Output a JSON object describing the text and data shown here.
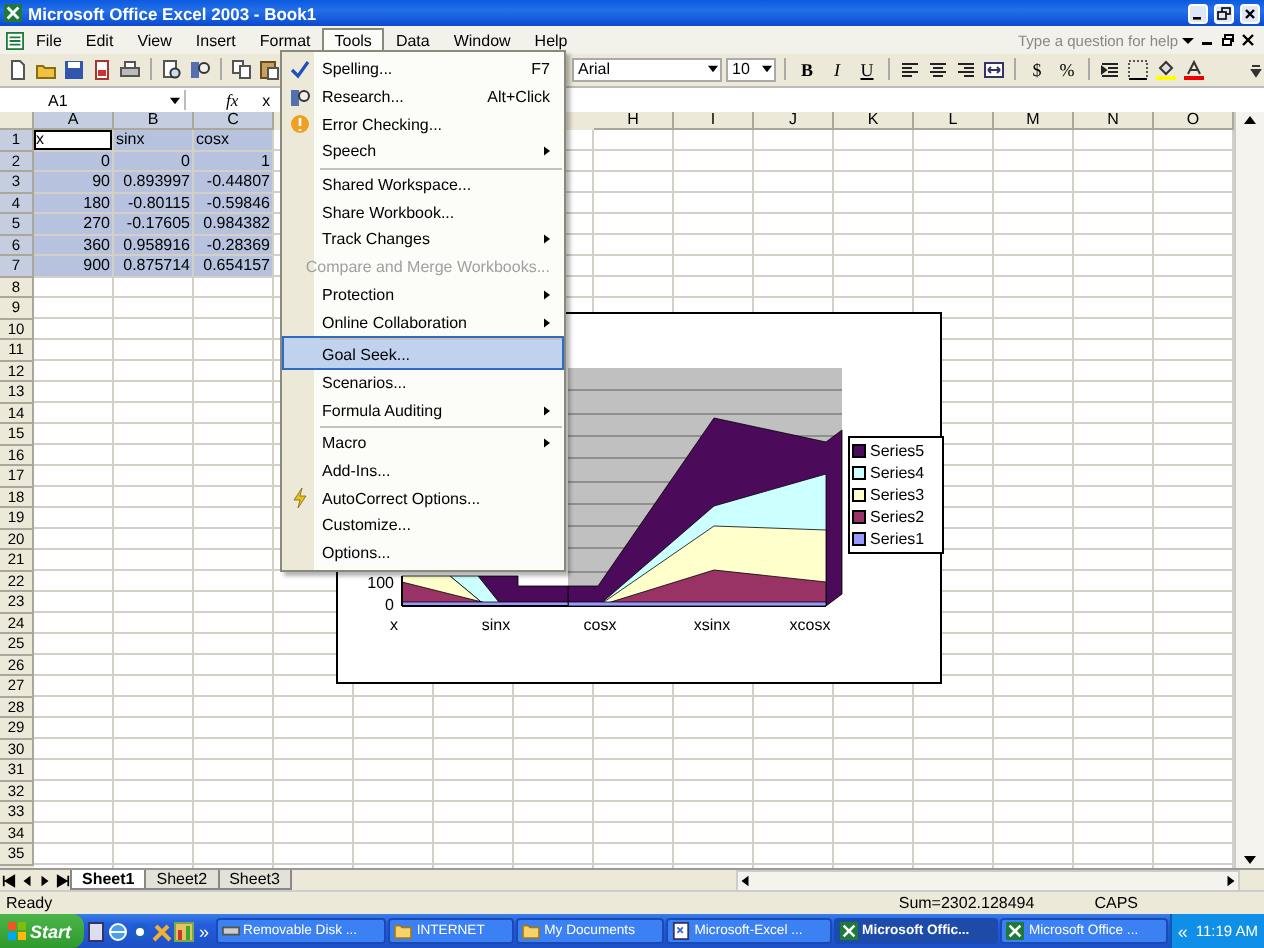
{
  "window": {
    "title": "Microsoft Office Excel 2003 - Book1"
  },
  "menu_bar": {
    "items": [
      {
        "label": "File",
        "selected": false
      },
      {
        "label": "Edit",
        "selected": false
      },
      {
        "label": "View",
        "selected": false
      },
      {
        "label": "Insert",
        "selected": false
      },
      {
        "label": "Format",
        "selected": false
      },
      {
        "label": "Tools",
        "selected": true
      },
      {
        "label": "Data",
        "selected": false
      },
      {
        "label": "Window",
        "selected": false
      },
      {
        "label": "Help",
        "selected": false
      }
    ],
    "help_placeholder": "Type a question for help"
  },
  "toolbar": {
    "font": "Arial",
    "font_size": "10",
    "style_buttons": [
      "B",
      "I",
      "U"
    ],
    "number_buttons": [
      "$",
      "%"
    ]
  },
  "formula_bar": {
    "name_box": "A1",
    "function_label": "fx",
    "formula": "x"
  },
  "sheet": {
    "columns": [
      {
        "label": "A",
        "selected": true
      },
      {
        "label": "B",
        "selected": true
      },
      {
        "label": "C",
        "selected": true
      },
      {
        "label": "H",
        "selected": false
      },
      {
        "label": "I",
        "selected": false
      },
      {
        "label": "J",
        "selected": false
      },
      {
        "label": "K",
        "selected": false
      },
      {
        "label": "L",
        "selected": false
      },
      {
        "label": "M",
        "selected": false
      },
      {
        "label": "N",
        "selected": false
      },
      {
        "label": "O",
        "selected": false
      }
    ],
    "rows": [
      {
        "header": "1",
        "selected": true,
        "cells": [
          {
            "text": "x",
            "kind": "label",
            "active": true
          },
          {
            "text": "sinx",
            "kind": "label",
            "active": false
          },
          {
            "text": "cosx",
            "kind": "label",
            "active": false
          }
        ]
      },
      {
        "header": "2",
        "selected": true,
        "cells": [
          {
            "text": "0",
            "kind": "number",
            "active": false
          },
          {
            "text": "0",
            "kind": "number",
            "active": false
          },
          {
            "text": "1",
            "kind": "number",
            "active": false
          }
        ]
      },
      {
        "header": "3",
        "selected": true,
        "cells": [
          {
            "text": "90",
            "kind": "number",
            "active": false
          },
          {
            "text": "0.893997",
            "kind": "number",
            "active": false
          },
          {
            "text": "-0.44807",
            "kind": "number",
            "active": false
          }
        ]
      },
      {
        "header": "4",
        "selected": true,
        "cells": [
          {
            "text": "180",
            "kind": "number",
            "active": false
          },
          {
            "text": "-0.80115",
            "kind": "number",
            "active": false
          },
          {
            "text": "-0.59846",
            "kind": "number",
            "active": false
          }
        ]
      },
      {
        "header": "5",
        "selected": true,
        "cells": [
          {
            "text": "270",
            "kind": "number",
            "active": false
          },
          {
            "text": "-0.17605",
            "kind": "number",
            "active": false
          },
          {
            "text": "0.984382",
            "kind": "number",
            "active": false
          }
        ]
      },
      {
        "header": "6",
        "selected": true,
        "cells": [
          {
            "text": "360",
            "kind": "number",
            "active": false
          },
          {
            "text": "0.958916",
            "kind": "number",
            "active": false
          },
          {
            "text": "-0.28369",
            "kind": "number",
            "active": false
          }
        ]
      },
      {
        "header": "7",
        "selected": true,
        "cells": [
          {
            "text": "900",
            "kind": "number",
            "active": false
          },
          {
            "text": "0.875714",
            "kind": "number",
            "active": false
          },
          {
            "text": "0.654157",
            "kind": "number",
            "active": false
          }
        ]
      },
      {
        "header": "8",
        "selected": false,
        "cells": []
      },
      {
        "header": "9",
        "selected": false,
        "cells": []
      },
      {
        "header": "10",
        "selected": false,
        "cells": []
      },
      {
        "header": "11",
        "selected": false,
        "cells": []
      },
      {
        "header": "12",
        "selected": false,
        "cells": []
      },
      {
        "header": "13",
        "selected": false,
        "cells": []
      },
      {
        "header": "14",
        "selected": false,
        "cells": []
      },
      {
        "header": "15",
        "selected": false,
        "cells": []
      },
      {
        "header": "16",
        "selected": false,
        "cells": []
      },
      {
        "header": "17",
        "selected": false,
        "cells": []
      },
      {
        "header": "18",
        "selected": false,
        "cells": []
      },
      {
        "header": "19",
        "selected": false,
        "cells": []
      },
      {
        "header": "20",
        "selected": false,
        "cells": []
      },
      {
        "header": "21",
        "selected": false,
        "cells": []
      },
      {
        "header": "22",
        "selected": false,
        "cells": []
      },
      {
        "header": "23",
        "selected": false,
        "cells": []
      },
      {
        "header": "24",
        "selected": false,
        "cells": []
      },
      {
        "header": "25",
        "selected": false,
        "cells": []
      },
      {
        "header": "26",
        "selected": false,
        "cells": []
      },
      {
        "header": "27",
        "selected": false,
        "cells": []
      },
      {
        "header": "28",
        "selected": false,
        "cells": []
      },
      {
        "header": "29",
        "selected": false,
        "cells": []
      },
      {
        "header": "30",
        "selected": false,
        "cells": []
      },
      {
        "header": "31",
        "selected": false,
        "cells": []
      },
      {
        "header": "32",
        "selected": false,
        "cells": []
      },
      {
        "header": "33",
        "selected": false,
        "cells": []
      },
      {
        "header": "34",
        "selected": false,
        "cells": []
      },
      {
        "header": "35",
        "selected": false,
        "cells": []
      }
    ]
  },
  "chart": {
    "y_ticks": [
      "100",
      "0"
    ],
    "categories": [
      "x",
      "sinx",
      "cosx",
      "xsinx",
      "xcosx"
    ],
    "legend": [
      {
        "label": "Series5",
        "color": "#4b0a5a"
      },
      {
        "label": "Series4",
        "color": "#ccffff"
      },
      {
        "label": "Series3",
        "color": "#ffffcc"
      },
      {
        "label": "Series2",
        "color": "#993366"
      },
      {
        "label": "Series1",
        "color": "#9999ff"
      }
    ]
  },
  "tools_menu": {
    "items": [
      {
        "label": "Spelling...",
        "shortcut": "F7",
        "kind": "spelling",
        "submenu": false,
        "disabled": false,
        "selected": false,
        "separator_before": false
      },
      {
        "label": "Research...",
        "shortcut": "Alt+Click",
        "kind": "research",
        "submenu": false,
        "disabled": false,
        "selected": false,
        "separator_before": false
      },
      {
        "label": "Error Checking...",
        "kind": "error",
        "submenu": false,
        "disabled": false,
        "selected": false,
        "separator_before": false
      },
      {
        "label": "Speech",
        "kind": "plain",
        "submenu": true,
        "disabled": false,
        "selected": false,
        "separator_before": false
      },
      {
        "label": "Shared Workspace...",
        "kind": "plain",
        "submenu": false,
        "disabled": false,
        "selected": false,
        "separator_before": true
      },
      {
        "label": "Share Workbook...",
        "kind": "plain",
        "submenu": false,
        "disabled": false,
        "selected": false,
        "separator_before": false
      },
      {
        "label": "Track Changes",
        "kind": "plain",
        "submenu": true,
        "disabled": false,
        "selected": false,
        "separator_before": false
      },
      {
        "label": "Compare and Merge Workbooks...",
        "kind": "plain",
        "submenu": false,
        "disabled": true,
        "selected": false,
        "separator_before": false
      },
      {
        "label": "Protection",
        "kind": "plain",
        "submenu": true,
        "disabled": false,
        "selected": false,
        "separator_before": false
      },
      {
        "label": "Online Collaboration",
        "kind": "plain",
        "submenu": true,
        "disabled": false,
        "selected": false,
        "separator_before": false
      },
      {
        "label": "Goal Seek...",
        "kind": "plain",
        "submenu": false,
        "disabled": false,
        "selected": true,
        "separator_before": true
      },
      {
        "label": "Scenarios...",
        "kind": "plain",
        "submenu": false,
        "disabled": false,
        "selected": false,
        "separator_before": false
      },
      {
        "label": "Formula Auditing",
        "kind": "plain",
        "submenu": true,
        "disabled": false,
        "selected": false,
        "separator_before": false
      },
      {
        "label": "Macro",
        "kind": "plain",
        "submenu": true,
        "disabled": false,
        "selected": false,
        "separator_before": true
      },
      {
        "label": "Add-Ins...",
        "kind": "plain",
        "submenu": false,
        "disabled": false,
        "selected": false,
        "separator_before": false
      },
      {
        "label": "AutoCorrect Options...",
        "kind": "autocorrect",
        "submenu": false,
        "disabled": false,
        "selected": false,
        "separator_before": false
      },
      {
        "label": "Customize...",
        "kind": "plain",
        "submenu": false,
        "disabled": false,
        "selected": false,
        "separator_before": false
      },
      {
        "label": "Options...",
        "kind": "plain",
        "submenu": false,
        "disabled": false,
        "selected": false,
        "separator_before": false
      }
    ]
  },
  "sheet_tabs": [
    {
      "label": "Sheet1",
      "selected": true
    },
    {
      "label": "Sheet2",
      "selected": false
    },
    {
      "label": "Sheet3",
      "selected": false
    }
  ],
  "status_bar": {
    "status": "Ready",
    "sum": "Sum=2302.128494",
    "caps": "CAPS"
  },
  "taskbar": {
    "start": "Start",
    "quick_launch_more": "»",
    "buttons": [
      {
        "label": "Removable Disk ...",
        "kind": "drive",
        "selected": false
      },
      {
        "label": "INTERNET",
        "kind": "folder",
        "selected": false
      },
      {
        "label": "My Documents",
        "kind": "folder",
        "selected": false
      },
      {
        "label": "Microsoft-Excel ...",
        "kind": "document",
        "selected": false
      },
      {
        "label": "Microsoft Offic...",
        "kind": "excel",
        "selected": true
      },
      {
        "label": "Microsoft Office ...",
        "kind": "excel",
        "selected": false
      }
    ],
    "tray_toggle": "«",
    "clock": "11:19 AM"
  }
}
